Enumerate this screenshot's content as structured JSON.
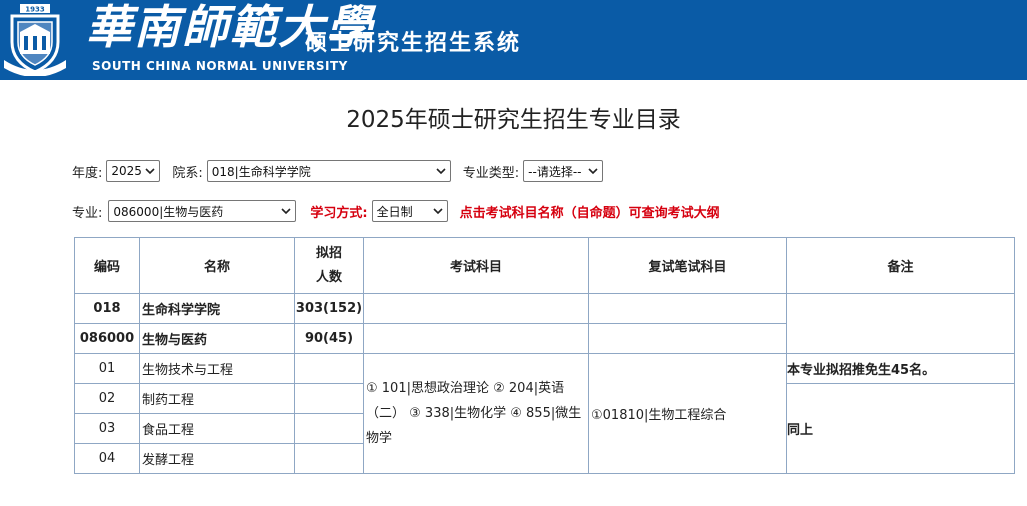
{
  "header": {
    "school_name": "華南師範大學",
    "system_name": "硕士研究生招生系统",
    "school_name_en": "SOUTH CHINA NORMAL UNIVERSITY",
    "logo_year": "1933",
    "banner_color": "#0a5ba6"
  },
  "page_title": "2025年硕士研究生招生专业目录",
  "filters": {
    "year_label": "年度:",
    "year_value": "2025",
    "dept_label": "院系:",
    "dept_value": "018|生命科学学院",
    "type_label": "专业类型:",
    "type_value": "--请选择--",
    "major_label": "专业:",
    "major_value": "086000|生物与医药",
    "mode_label": "学习方式:",
    "mode_value": "全日制",
    "hint": "点击考试科目名称（自命题）可查询考试大纲",
    "hint_color": "#d6000f"
  },
  "table": {
    "headers": {
      "code": "编码",
      "name": "名称",
      "plan_line1": "拟招",
      "plan_line2": "人数",
      "exam": "考试科目",
      "retest": "复试笔试科目",
      "remark": "备注"
    },
    "college_row": {
      "code": "018",
      "name": "生命科学学院",
      "plan": "303(152)"
    },
    "major_row": {
      "code": "086000",
      "name": "生物与医药",
      "plan": "90(45)"
    },
    "directions": [
      {
        "code": "01",
        "name": "生物技术与工程"
      },
      {
        "code": "02",
        "name": "制药工程"
      },
      {
        "code": "03",
        "name": "食品工程"
      },
      {
        "code": "04",
        "name": "发酵工程"
      }
    ],
    "exam_line1": "① 101|思想政治理论 ② 204|英语",
    "exam_line2": "（二） ③ 338|生物化学 ④ 855|微生",
    "exam_line3": "物学",
    "retest_subject": "①01810|生物工程综合",
    "remark_first": "本专业拟招推免生45名。",
    "remark_rest": "同上"
  }
}
